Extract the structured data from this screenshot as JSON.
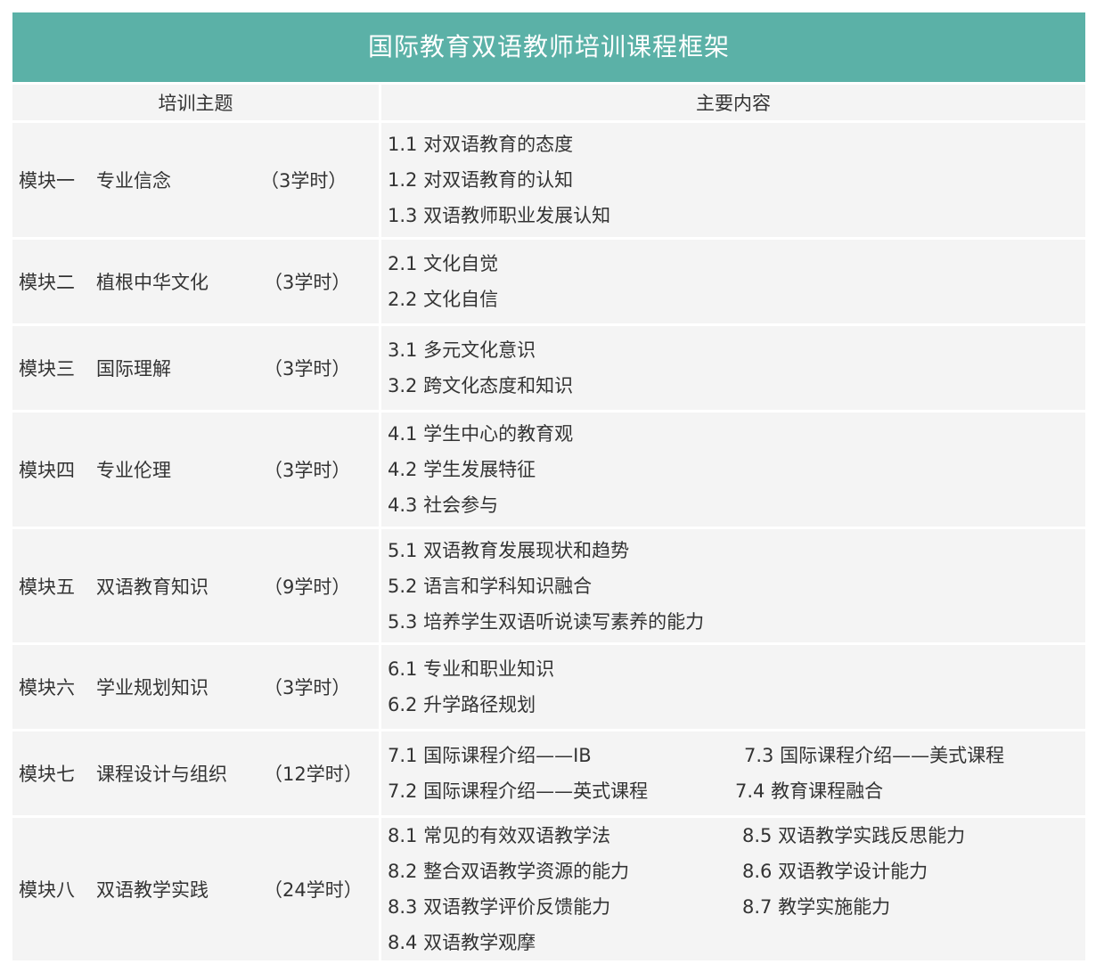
{
  "title": "国际教育双语教师培训课程框架",
  "header": {
    "col1": "培训主题",
    "col2": "主要内容"
  },
  "rows": [
    {
      "id": "模块一",
      "name": "专业信念",
      "hours": "（3学时）",
      "items": [
        "1.1 对双语教育的态度",
        "1.2 对双语教育的认知",
        "1.3 双语教师职业发展认知"
      ]
    },
    {
      "id": "模块二",
      "name": "植根中华文化",
      "hours": "（3学时）",
      "items": [
        "2.1 文化自觉",
        "2.2 文化自信"
      ]
    },
    {
      "id": "模块三",
      "name": "国际理解",
      "hours": "（3学时）",
      "items": [
        "3.1 多元文化意识",
        "3.2 跨文化态度和知识"
      ]
    },
    {
      "id": "模块四",
      "name": "专业伦理",
      "hours": "（3学时）",
      "items": [
        "4.1 学生中心的教育观",
        "4.2 学生发展特征",
        "4.3 社会参与"
      ]
    },
    {
      "id": "模块五",
      "name": "双语教育知识",
      "hours": "（9学时）",
      "items": [
        "5.1 双语教育发展现状和趋势",
        "5.2 语言和学科知识融合",
        "5.3 培养学生双语听说读写素养的能力"
      ]
    },
    {
      "id": "模块六",
      "name": "学业规划知识",
      "hours": "（3学时）",
      "items": [
        "6.1 专业和职业知识",
        "6.2 升学路径规划"
      ]
    },
    {
      "id": "模块七",
      "name": "课程设计与组织",
      "hours": "（12学时）",
      "items_left": [
        "7.1 国际课程介绍——IB",
        "7.2 国际课程介绍——英式课程"
      ],
      "items_right": [
        "7.3 国际课程介绍——美式课程",
        "7.4 教育课程融合"
      ]
    },
    {
      "id": "模块八",
      "name": "双语教学实践",
      "hours": "（24学时）",
      "items_left": [
        "8.1 常见的有效双语教学法",
        "8.2 整合双语教学资源的能力",
        "8.3 双语教学评价反馈能力",
        "8.4 双语教学观摩"
      ],
      "items_right": [
        "8.5 双语教学实践反思能力",
        "8.6 双语教学设计能力",
        "8.7 教学实施能力"
      ]
    }
  ]
}
